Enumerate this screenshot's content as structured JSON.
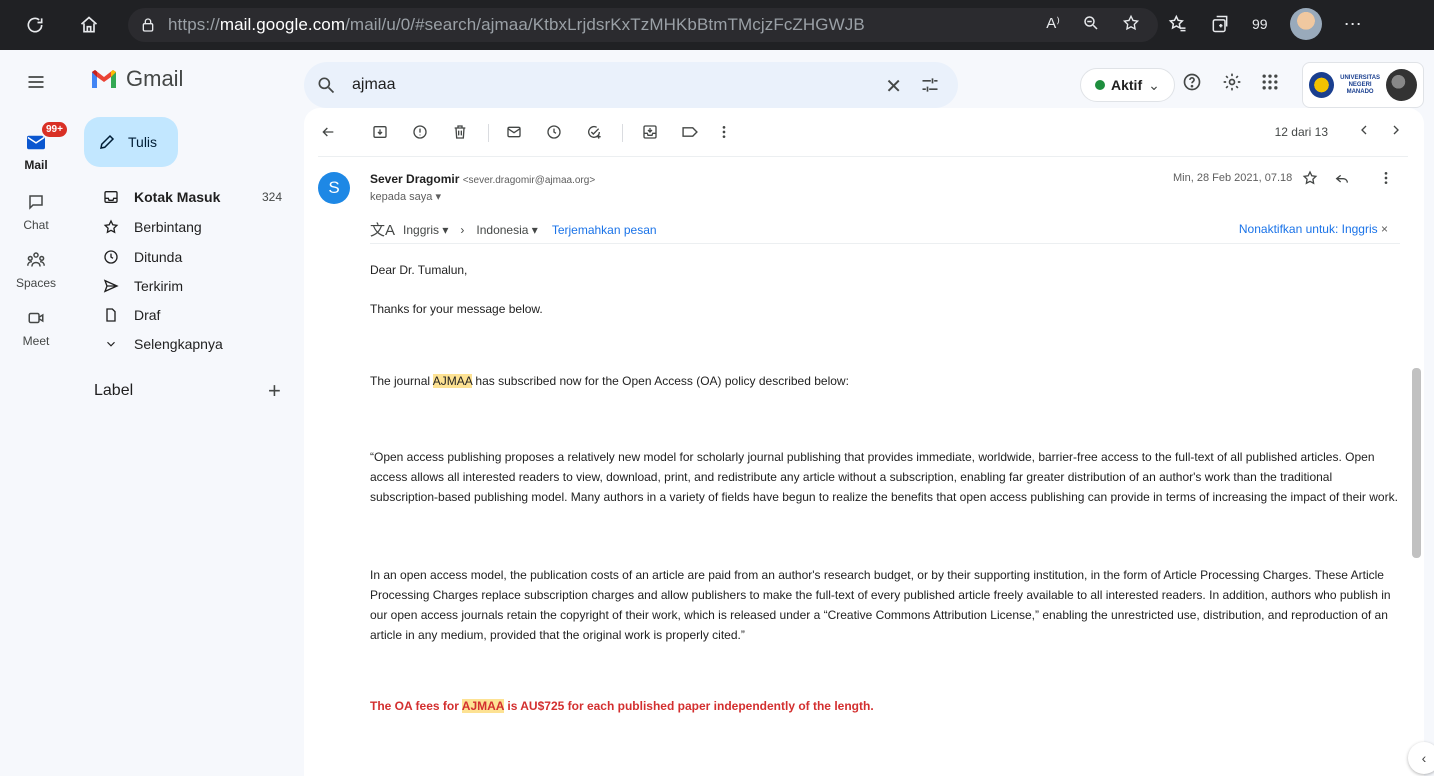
{
  "browser": {
    "url_prefix": "https://",
    "url_domain": "mail.google.com",
    "url_path": "/mail/u/0/#search/ajmaa/KtbxLrjdsrKxTzMHKbBtmTMcjzFcZHGWJB",
    "read_aloud": "A⁾",
    "extension_count": "99"
  },
  "gmail": {
    "logo_text": "Gmail",
    "search_value": "ajmaa",
    "status_label": "Aktif",
    "university_logo_text": "UNIVERSITAS NEGERI MANADO"
  },
  "rail": {
    "mail_badge": "99+",
    "mail_label": "Mail",
    "chat_label": "Chat",
    "spaces_label": "Spaces",
    "meet_label": "Meet"
  },
  "nav": {
    "compose_label": "Tulis",
    "items": [
      {
        "label": "Kotak Masuk",
        "count": "324",
        "icon": "inbox-icon"
      },
      {
        "label": "Berbintang",
        "count": "",
        "icon": "star-icon"
      },
      {
        "label": "Ditunda",
        "count": "",
        "icon": "clock-icon"
      },
      {
        "label": "Terkirim",
        "count": "",
        "icon": "send-icon"
      },
      {
        "label": "Draf",
        "count": "",
        "icon": "draft-icon"
      },
      {
        "label": "Selengkapnya",
        "count": "",
        "icon": "chevron-down-icon"
      }
    ],
    "label_header": "Label",
    "label_add": "+"
  },
  "toolbar": {
    "pager_text": "12 dari 13"
  },
  "message": {
    "avatar_letter": "S",
    "sender_name": "Sever Dragomir",
    "sender_email": "<sever.dragomir@ajmaa.org>",
    "to_text": "kepada saya",
    "date": "Min, 28 Feb 2021, 07.18",
    "translate_from": "Inggris",
    "translate_to": "Indonesia",
    "translate_link": "Terjemahkan pesan",
    "translate_disable": "Nonaktifkan untuk: Inggris",
    "greeting": "Dear Dr. Tumalun,",
    "thanks": "Thanks for your message below.",
    "p1_before": "The journal ",
    "p1_highlight": "AJMAA",
    "p1_after": " has subscribed  now for the Open Access (OA) policy described below:",
    "p2": "“Open access publishing proposes a relatively new model for scholarly journal publishing that provides immediate, worldwide, barrier-free access to the full-text of all published articles. Open access allows all interested readers to view, download, print, and redistribute any article without a subscription, enabling far greater distribution of an author's work than the traditional subscription-based publishing model. Many authors in a variety of fields have begun to realize the benefits that open access publishing can provide in terms of increasing the impact of their work.",
    "p3": "In an open access model, the publication costs of an article are paid from an author's research budget, or by their supporting institution, in the form of Article Processing Charges. These Article Processing Charges replace subscription charges and allow publishers to make the full-text of every published article freely available to all interested readers. In addition, authors who publish in our open access journals retain the copyright of their work, which is released under a “Creative Commons Attribution License,” enabling the unrestricted use, distribution, and reproduction of an article in any medium, provided that the original work is properly cited.”",
    "p4_before": "The OA fees for ",
    "p4_highlight": "AJMAA",
    "p4_after": " is AU$725 for each published paper independently of the length."
  },
  "colors": {
    "compose_bg": "#c2e7ff",
    "search_bg": "#eaf1fb",
    "highlight": "#fde293",
    "fee_text": "#d32f2f",
    "badge": "#d93025",
    "status_dot": "#1e8e3e"
  }
}
